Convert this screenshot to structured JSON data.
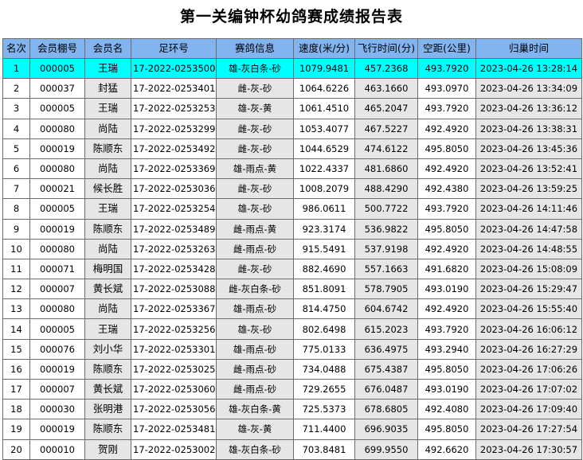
{
  "title": "第一关编钟杯幼鸽赛成绩报告表",
  "columns": [
    "名次",
    "会员棚号",
    "会员名",
    "足环号",
    "赛鸽信息",
    "速度(米/分)",
    "飞行时间(分)",
    "空距(公里)",
    "归巢时间"
  ],
  "highlight_color": "#00ffff",
  "header_color": "#82b4f0",
  "rows": [
    [
      "1",
      "000005",
      "王瑞",
      "17-2022-0253500",
      "雄-灰白条-砂",
      "1079.9481",
      "457.2368",
      "493.7920",
      "2023-04-26 13:28:14"
    ],
    [
      "2",
      "000037",
      "封猛",
      "17-2022-0253401",
      "雌-灰-砂",
      "1064.6226",
      "463.1660",
      "493.0970",
      "2023-04-26 13:34:09"
    ],
    [
      "3",
      "000005",
      "王瑞",
      "17-2022-0253253",
      "雄-灰-黄",
      "1061.4510",
      "465.2047",
      "493.7920",
      "2023-04-26 13:36:12"
    ],
    [
      "4",
      "000080",
      "尚陆",
      "17-2022-0253299",
      "雌-灰-砂",
      "1053.4077",
      "467.5227",
      "492.4920",
      "2023-04-26 13:38:31"
    ],
    [
      "5",
      "000019",
      "陈顺东",
      "17-2022-0253492",
      "雌-灰-砂",
      "1044.6529",
      "474.6122",
      "495.8050",
      "2023-04-26 13:45:36"
    ],
    [
      "6",
      "000080",
      "尚陆",
      "17-2022-0253369",
      "雄-雨点-黄",
      "1022.4337",
      "481.6860",
      "492.4920",
      "2023-04-26 13:52:41"
    ],
    [
      "7",
      "000021",
      "候长胜",
      "17-2022-0253036",
      "雌-灰-砂",
      "1008.2079",
      "488.4290",
      "492.4380",
      "2023-04-26 13:59:25"
    ],
    [
      "8",
      "000005",
      "王瑞",
      "17-2022-0253254",
      "雄-灰-砂",
      "986.0611",
      "500.7722",
      "493.7920",
      "2023-04-26 14:11:46"
    ],
    [
      "9",
      "000019",
      "陈顺东",
      "17-2022-0253489",
      "雌-雨点-黄",
      "923.3174",
      "536.9822",
      "495.8050",
      "2023-04-26 14:47:58"
    ],
    [
      "10",
      "000080",
      "尚陆",
      "17-2022-0253263",
      "雌-雨点-砂",
      "915.5491",
      "537.9198",
      "492.4920",
      "2023-04-26 14:48:55"
    ],
    [
      "11",
      "000071",
      "梅明国",
      "17-2022-0253428",
      "雌-灰-砂",
      "882.4690",
      "557.1663",
      "491.6820",
      "2023-04-26 15:08:09"
    ],
    [
      "12",
      "000007",
      "黄长斌",
      "17-2022-0253088",
      "雌-灰白条-砂",
      "851.8091",
      "578.7905",
      "493.0190",
      "2023-04-26 15:29:47"
    ],
    [
      "13",
      "000080",
      "尚陆",
      "17-2022-0253367",
      "雄-雨点-砂",
      "814.4750",
      "604.6742",
      "492.4920",
      "2023-04-26 15:55:40"
    ],
    [
      "14",
      "000005",
      "王瑞",
      "17-2022-0253256",
      "雄-灰-砂",
      "802.6498",
      "615.2023",
      "493.7920",
      "2023-04-26 16:06:12"
    ],
    [
      "15",
      "000076",
      "刘小华",
      "17-2022-0253301",
      "雄-雨点-砂",
      "775.0133",
      "636.4975",
      "493.2940",
      "2023-04-26 16:27:29"
    ],
    [
      "16",
      "000019",
      "陈顺东",
      "17-2022-0253025",
      "雌-雨点-砂",
      "734.0488",
      "675.4387",
      "495.8050",
      "2023-04-26 17:06:26"
    ],
    [
      "17",
      "000007",
      "黄长斌",
      "17-2022-0253060",
      "雌-雨点-砂",
      "729.2655",
      "676.0487",
      "493.0190",
      "2023-04-26 17:07:02"
    ],
    [
      "18",
      "000030",
      "张明港",
      "17-2022-0253056",
      "雄-灰白条-黄",
      "725.5373",
      "678.6805",
      "492.4080",
      "2023-04-26 17:09:40"
    ],
    [
      "19",
      "000019",
      "陈顺东",
      "17-2022-0253481",
      "雄-灰-黄",
      "711.4400",
      "696.9035",
      "495.8050",
      "2023-04-26 17:27:54"
    ],
    [
      "20",
      "000010",
      "贺刚",
      "17-2022-0253002",
      "雄-灰白条-砂",
      "703.8481",
      "699.9550",
      "492.6620",
      "2023-04-26 17:30:57"
    ]
  ]
}
